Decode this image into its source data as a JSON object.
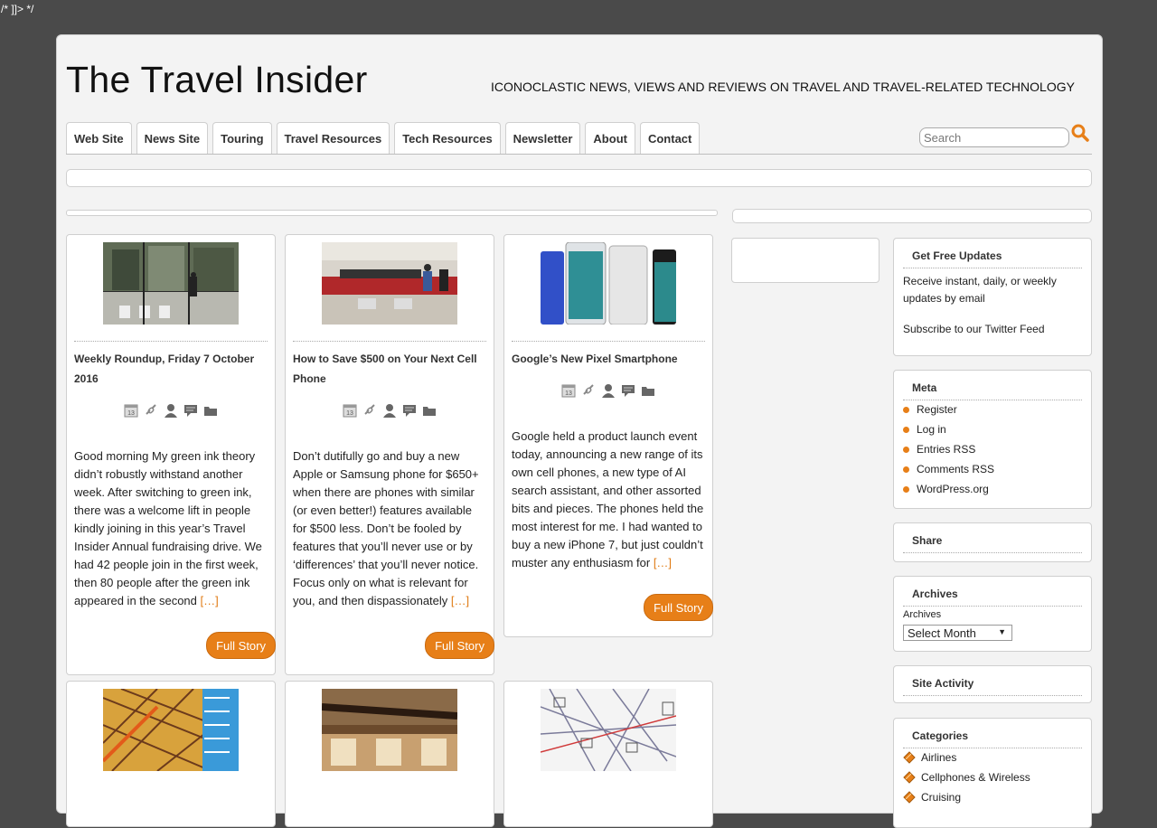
{
  "artifact_text": "/* ]]> */",
  "header": {
    "site_title": "The Travel Insider",
    "tagline": "ICONOCLASTIC NEWS, VIEWS AND REVIEWS ON TRAVEL AND TRAVEL-RELATED TECHNOLOGY"
  },
  "nav": {
    "items": [
      {
        "label": "Web Site"
      },
      {
        "label": "News Site"
      },
      {
        "label": "Touring"
      },
      {
        "label": "Travel Resources"
      },
      {
        "label": "Tech Resources"
      },
      {
        "label": "Newsletter"
      },
      {
        "label": "About"
      },
      {
        "label": "Contact"
      }
    ]
  },
  "search": {
    "placeholder": "Search",
    "icon": "search-icon"
  },
  "posts": [
    {
      "title": "Weekly Roundup, Friday 7 October 2016",
      "excerpt": "Good morning My green ink theory didn’t robustly withstand another week.  After switching to green ink, there was a welcome lift in people kindly joining in this year’s Travel Insider Annual fundraising drive.  We had 42 people join in the first week, then 80 people after the green ink appeared in the second",
      "more": "[…]",
      "button": "Full Story"
    },
    {
      "title": "How to Save $500 on Your Next Cell Phone",
      "excerpt": "Don’t dutifully go and buy a new Apple or Samsung phone for $650+ when there are phones with similar (or even better!) features available for $500 less. Don’t be fooled by features that you’ll never use or by ‘differences’ that you’ll never notice. Focus only on what is relevant for you, and then dispassionately",
      "more": "[…]",
      "button": "Full Story"
    },
    {
      "title": "Google’s New Pixel Smartphone",
      "excerpt": "Google held a product launch event today, announcing a new range of its own cell phones, a new type of AI search assistant, and other assorted bits and pieces. The phones held the most interest for me.  I had wanted to buy a new iPhone 7, but just couldn’t muster any enthusiasm for",
      "more": "[…]",
      "button": "Full Story"
    }
  ],
  "meta_icons": [
    "calendar-icon",
    "link-icon",
    "author-icon",
    "comments-icon",
    "folder-icon"
  ],
  "sidebar": {
    "updates": {
      "title": "Get Free Updates",
      "text": "Receive instant, daily, or weekly updates by email",
      "twitter": "Subscribe to our Twitter Feed"
    },
    "meta": {
      "title": "Meta",
      "items": [
        "Register",
        "Log in",
        "Entries RSS",
        "Comments RSS",
        "WordPress.org"
      ]
    },
    "share": {
      "title": "Share"
    },
    "archives": {
      "title": "Archives",
      "label": "Archives",
      "select_value": "Select Month"
    },
    "activity": {
      "title": "Site Activity"
    },
    "categories": {
      "title": "Categories",
      "items": [
        "Airlines",
        "Cellphones & Wireless",
        "Cruising"
      ]
    }
  },
  "colors": {
    "accent": "#e77f18",
    "background": "#4a4a4a",
    "page": "#f3f3f3"
  }
}
